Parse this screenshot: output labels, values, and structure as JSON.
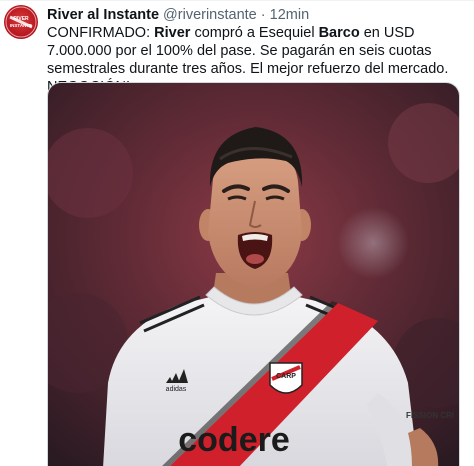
{
  "tweet": {
    "author_name": "River al Instante",
    "author_handle": "@riverinstante",
    "separator": "·",
    "time": "12min",
    "text": {
      "p1": "CONFIRMADO: ",
      "b1": "River",
      "p2": " compró a Esequiel ",
      "b2": "Barco",
      "p3": " en USD 7.000.000 por el 100% del pase. Se pagarán en seis cuotas semestrales durante tres años. El mejor refuerzo del mercado. NEGOCIÓN!"
    },
    "avatar_text": "RIVER AL INSTANTE",
    "media": {
      "kind": "photo",
      "jersey_sponsor": "codere",
      "kit_brand": "adidas",
      "sleeve_text": "FISSION CRI"
    }
  },
  "colors": {
    "primary_text": "#0f1419",
    "secondary_text": "#536471",
    "river_red": "#d0202b"
  }
}
